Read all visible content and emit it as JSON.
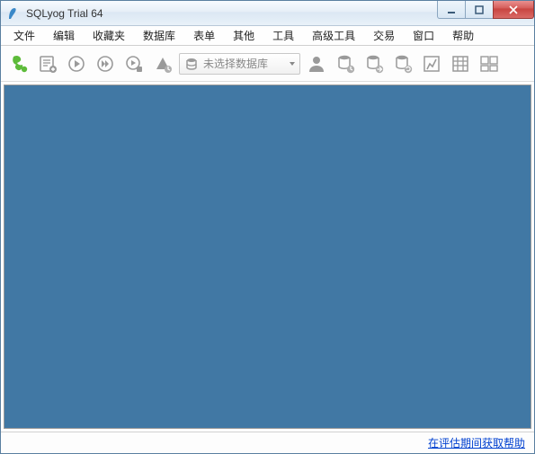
{
  "titlebar": {
    "title": "SQLyog Trial 64"
  },
  "menu": {
    "items": [
      "文件",
      "编辑",
      "收藏夹",
      "数据库",
      "表单",
      "其他",
      "工具",
      "高级工具",
      "交易",
      "窗口",
      "帮助"
    ]
  },
  "toolbar": {
    "db_select_placeholder": "未选择数据库"
  },
  "statusbar": {
    "help_link": "在评估期间获取帮助"
  }
}
